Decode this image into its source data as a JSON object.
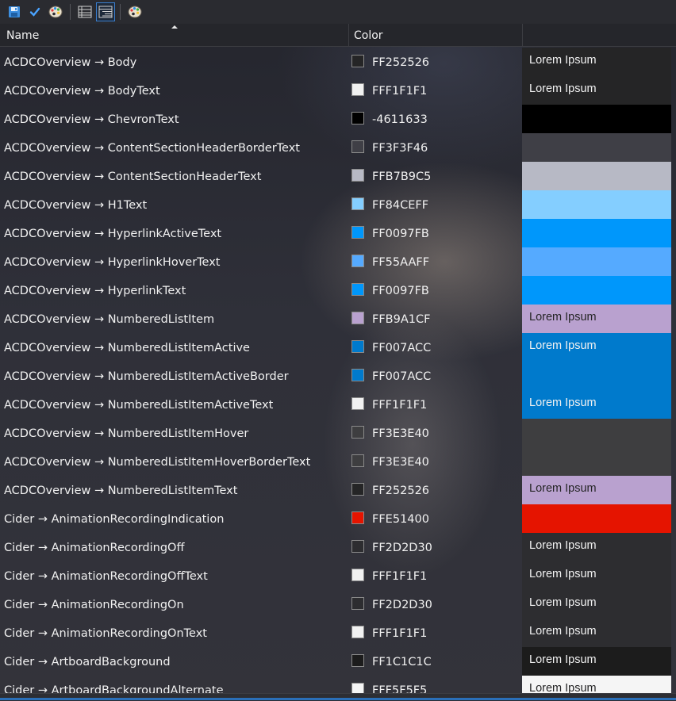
{
  "toolbar": {
    "buttons": [
      {
        "icon": "save-icon"
      },
      {
        "icon": "check-icon"
      },
      {
        "icon": "palette-icon"
      },
      {
        "icon": "list-view-icon"
      },
      {
        "icon": "tree-view-icon",
        "active": true
      },
      {
        "icon": "theme-palette-icon"
      }
    ]
  },
  "columns": {
    "name": "Name",
    "color": "Color",
    "preview": ""
  },
  "rows": [
    {
      "name": "ACDCOverview → Body",
      "hex": "FF252526",
      "swatch": "#252526",
      "preview_bg": "#252526",
      "preview_text": "Lorem Ipsum",
      "preview_fg": "#f1f1f1"
    },
    {
      "name": "ACDCOverview → BodyText",
      "hex": "FFF1F1F1",
      "swatch": "#F1F1F1",
      "preview_bg": "#252526",
      "preview_text": "Lorem Ipsum",
      "preview_fg": "#f1f1f1"
    },
    {
      "name": "ACDCOverview → ChevronText",
      "hex": "-4611633",
      "swatch": "#000000",
      "preview_bg": "#000000",
      "preview_text": "",
      "preview_fg": "#f1f1f1"
    },
    {
      "name": "ACDCOverview → ContentSectionHeaderBorderText",
      "hex": "FF3F3F46",
      "swatch": "#3F3F46",
      "preview_bg": "#3F3F46",
      "preview_text": "",
      "preview_fg": "#f1f1f1"
    },
    {
      "name": "ACDCOverview → ContentSectionHeaderText",
      "hex": "FFB7B9C5",
      "swatch": "#B7B9C5",
      "preview_bg": "#B7B9C5",
      "preview_text": "",
      "preview_fg": "#f1f1f1"
    },
    {
      "name": "ACDCOverview → H1Text",
      "hex": "FF84CEFF",
      "swatch": "#84CEFF",
      "preview_bg": "#84CEFF",
      "preview_text": "",
      "preview_fg": "#f1f1f1"
    },
    {
      "name": "ACDCOverview → HyperlinkActiveText",
      "hex": "FF0097FB",
      "swatch": "#0097FB",
      "preview_bg": "#0097FB",
      "preview_text": "",
      "preview_fg": "#f1f1f1"
    },
    {
      "name": "ACDCOverview → HyperlinkHoverText",
      "hex": "FF55AAFF",
      "swatch": "#55AAFF",
      "preview_bg": "#55AAFF",
      "preview_text": "",
      "preview_fg": "#f1f1f1"
    },
    {
      "name": "ACDCOverview → HyperlinkText",
      "hex": "FF0097FB",
      "swatch": "#0097FB",
      "preview_bg": "#0097FB",
      "preview_text": "",
      "preview_fg": "#f1f1f1"
    },
    {
      "name": "ACDCOverview → NumberedListItem",
      "hex": "FFB9A1CF",
      "swatch": "#B9A1CF",
      "preview_bg": "#B9A1CF",
      "preview_text": "Lorem Ipsum",
      "preview_fg": "#252526"
    },
    {
      "name": "ACDCOverview → NumberedListItemActive",
      "hex": "FF007ACC",
      "swatch": "#007ACC",
      "preview_bg": "#007ACC",
      "preview_text": "Lorem Ipsum",
      "preview_fg": "#f1f1f1"
    },
    {
      "name": "ACDCOverview → NumberedListItemActiveBorder",
      "hex": "FF007ACC",
      "swatch": "#007ACC",
      "preview_bg": "#007ACC",
      "preview_text": "",
      "preview_fg": "#f1f1f1"
    },
    {
      "name": "ACDCOverview → NumberedListItemActiveText",
      "hex": "FFF1F1F1",
      "swatch": "#F1F1F1",
      "preview_bg": "#007ACC",
      "preview_text": "Lorem Ipsum",
      "preview_fg": "#f1f1f1"
    },
    {
      "name": "ACDCOverview → NumberedListItemHover",
      "hex": "FF3E3E40",
      "swatch": "#3E3E40",
      "preview_bg": "#3E3E40",
      "preview_text": "",
      "preview_fg": "#f1f1f1"
    },
    {
      "name": "ACDCOverview → NumberedListItemHoverBorderText",
      "hex": "FF3E3E40",
      "swatch": "#3E3E40",
      "preview_bg": "#3E3E40",
      "preview_text": "",
      "preview_fg": "#f1f1f1"
    },
    {
      "name": "ACDCOverview → NumberedListItemText",
      "hex": "FF252526",
      "swatch": "#252526",
      "preview_bg": "#B9A1CF",
      "preview_text": "Lorem Ipsum",
      "preview_fg": "#252526"
    },
    {
      "name": "Cider → AnimationRecordingIndication",
      "hex": "FFE51400",
      "swatch": "#E51400",
      "preview_bg": "#E51400",
      "preview_text": "",
      "preview_fg": "#f1f1f1"
    },
    {
      "name": "Cider → AnimationRecordingOff",
      "hex": "FF2D2D30",
      "swatch": "#2D2D30",
      "preview_bg": "#2D2D30",
      "preview_text": "Lorem Ipsum",
      "preview_fg": "#f1f1f1"
    },
    {
      "name": "Cider → AnimationRecordingOffText",
      "hex": "FFF1F1F1",
      "swatch": "#F1F1F1",
      "preview_bg": "#2D2D30",
      "preview_text": "Lorem Ipsum",
      "preview_fg": "#f1f1f1"
    },
    {
      "name": "Cider → AnimationRecordingOn",
      "hex": "FF2D2D30",
      "swatch": "#2D2D30",
      "preview_bg": "#2D2D30",
      "preview_text": "Lorem Ipsum",
      "preview_fg": "#f1f1f1"
    },
    {
      "name": "Cider → AnimationRecordingOnText",
      "hex": "FFF1F1F1",
      "swatch": "#F1F1F1",
      "preview_bg": "#2D2D30",
      "preview_text": "Lorem Ipsum",
      "preview_fg": "#f1f1f1"
    },
    {
      "name": "Cider → ArtboardBackground",
      "hex": "FF1C1C1C",
      "swatch": "#1C1C1C",
      "preview_bg": "#1C1C1C",
      "preview_text": "Lorem Ipsum",
      "preview_fg": "#f1f1f1"
    },
    {
      "name": "Cider → ArtboardBackgroundAlternate",
      "hex": "FFF5F5F5",
      "swatch": "#F5F5F5",
      "preview_bg": "#F5F5F5",
      "preview_text": "Lorem Ipsum",
      "preview_fg": "#252526"
    }
  ]
}
